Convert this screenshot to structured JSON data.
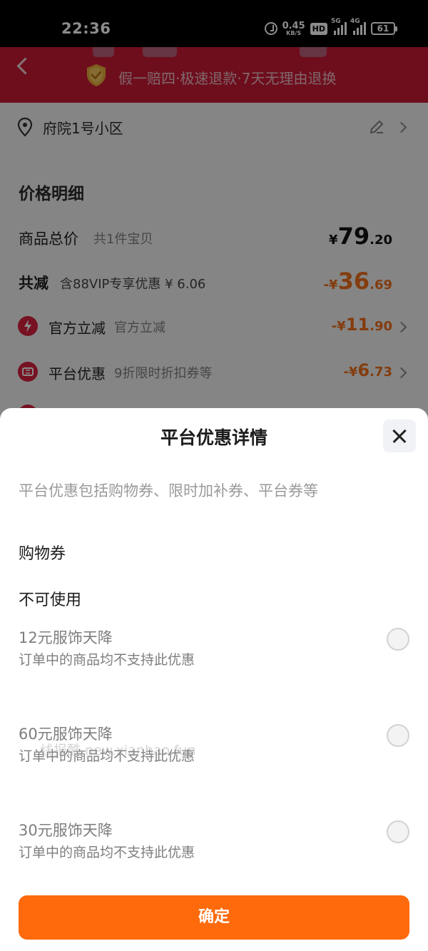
{
  "status_bar": {
    "time": "22:36",
    "net_speed_value": "0.45",
    "net_speed_unit": "KB/S",
    "hd_label": "HD",
    "signal1_label": "5G",
    "signal2_label": "4G",
    "battery": "61",
    "icons": [
      "alarm-icon",
      "hd-icon",
      "signal-icon",
      "battery-icon"
    ]
  },
  "header": {
    "promise_text": "假一赔四·极速退款·7天无理由退换",
    "back_icon": "chevron-left-icon",
    "shield_icon": "shield-check-icon"
  },
  "address": {
    "text": "府院1号小区",
    "pin_icon": "location-pin-icon",
    "edit_icon": "edit-pencil-icon"
  },
  "price_detail": {
    "title": "价格明细",
    "total": {
      "label": "商品总价",
      "sub": "共1件宝贝",
      "currency": "¥",
      "int": "79",
      "dec": ".20"
    },
    "reduce": {
      "label": "共减",
      "sub": "含88VIP专享优惠 ¥ 6.06",
      "prefix": "-¥",
      "int": "36",
      "dec": ".69"
    },
    "official": {
      "label": "官方立减",
      "sub": "官方立减",
      "prefix": "-¥",
      "int": "11",
      "dec": ".90"
    },
    "platform": {
      "label": "平台优惠",
      "sub": "9折限时折扣券等",
      "prefix": "-¥",
      "int": "6",
      "dec": ".73"
    }
  },
  "sheet": {
    "title": "平台优惠详情",
    "description": "平台优惠包括购物券、限时加补券、平台券等",
    "section": "购物券",
    "group": "不可使用",
    "coupons": [
      {
        "name": "12元服饰天降",
        "note": "订单中的商品均不支持此优惠"
      },
      {
        "name": "60元服饰天降",
        "note": "订单中的商品均不支持此优惠"
      },
      {
        "name": "30元服饰天降",
        "note": "订单中的商品均不支持此优惠"
      }
    ],
    "watermark": "线报酷 new.xianbao.fun",
    "confirm": "确定"
  },
  "colors": {
    "header_red": "#c91b36",
    "accent_orange": "#fe6a0c",
    "price_orange": "#ef6f1c"
  }
}
